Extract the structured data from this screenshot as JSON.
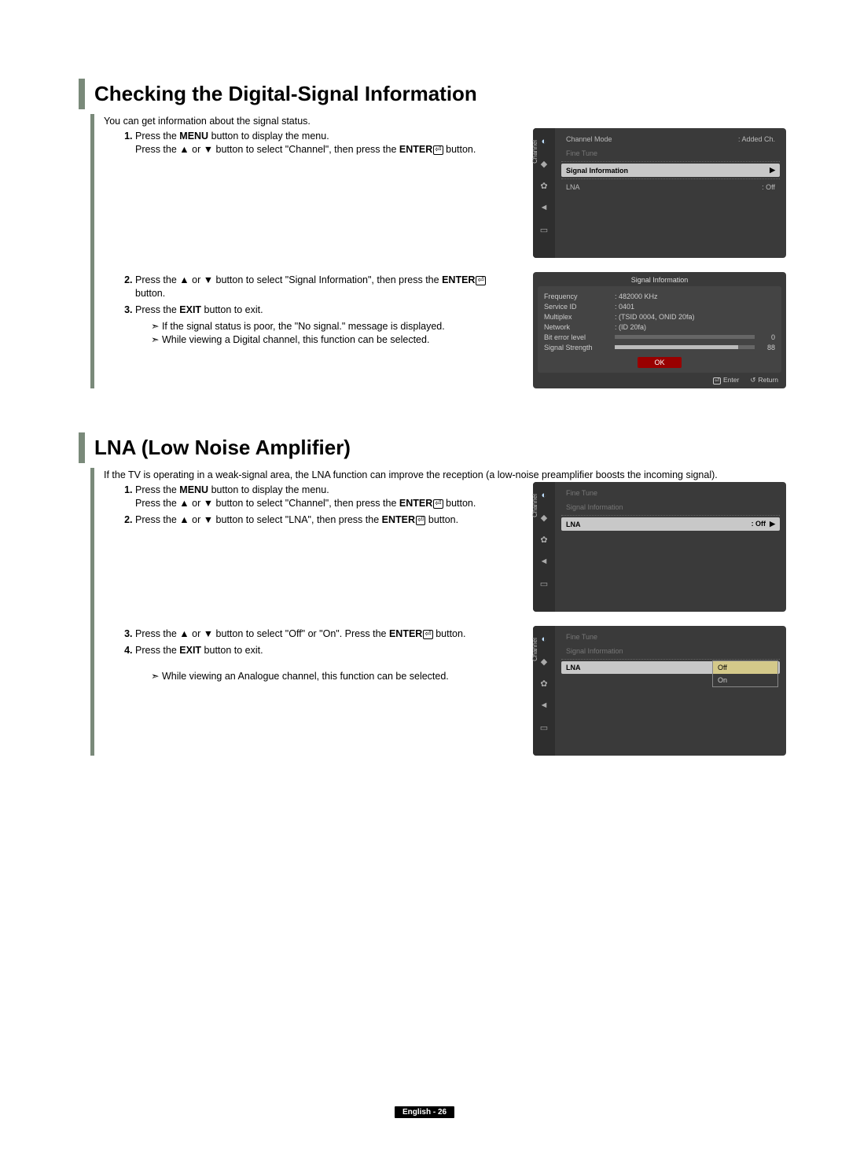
{
  "section1": {
    "title": "Checking the Digital-Signal Information",
    "intro": "You can get information about the signal status.",
    "steps": {
      "s1a": "Press the ",
      "s1_menu": "MENU",
      "s1b": " button to display the menu.",
      "s1c": "Press the ▲ or ▼ button to select \"Channel\", then press the ",
      "s1_enter": "ENTER",
      "s1d": " button.",
      "s2a": "Press the ▲ or ▼ button to select \"Signal Information\", then press the ",
      "s2_enter": "ENTER",
      "s2b": " button.",
      "s3a": "Press the ",
      "s3_exit": "EXIT",
      "s3b": " button to exit."
    },
    "notes": {
      "n1": "If the signal status is poor, the \"No signal.\" message is displayed.",
      "n2": "While viewing a Digital channel, this function can be selected."
    }
  },
  "section2": {
    "title": "LNA (Low Noise Amplifier)",
    "intro": "If the TV is operating in a weak-signal area, the LNA function can improve the reception (a low-noise preamplifier boosts the incoming signal).",
    "steps": {
      "s1a": "Press the ",
      "s1_menu": "MENU",
      "s1b": " button to display the menu.",
      "s1c": "Press the ▲ or ▼ button to select \"Channel\", then press the ",
      "s1_enter": "ENTER",
      "s1d": " button.",
      "s2a": "Press the ▲ or ▼ button to select \"LNA\", then press the ",
      "s2_enter": "ENTER",
      "s2b": " button.",
      "s3a": "Press the ▲ or ▼ button to select \"Off\" or \"On\". Press the ",
      "s3_enter": "ENTER",
      "s3b": " button.",
      "s4a": "Press the ",
      "s4_exit": "EXIT",
      "s4b": " button to exit."
    },
    "notes": {
      "n1": "While viewing an Analogue channel, this function can be selected."
    }
  },
  "osd_menu1": {
    "side_label": "Channel",
    "rows": {
      "r1_label": "Channel Mode",
      "r1_value": ": Added Ch.",
      "r2_label": "Fine Tune",
      "r3_label": "Signal Information",
      "r4_label": "LNA",
      "r4_value": ": Off"
    }
  },
  "osd_info": {
    "title": "Signal Information",
    "rows": {
      "freq_label": "Frequency",
      "freq_value": ": 482000 KHz",
      "svc_label": "Service ID",
      "svc_value": ": 0401",
      "mux_label": "Multiplex",
      "mux_value": ": (TSID 0004, ONID 20fa)",
      "net_label": "Network",
      "net_value": ": (ID 20fa)",
      "bit_label": "Bit error level",
      "bit_value": "0",
      "sig_label": "Signal Strength",
      "sig_value": "88"
    },
    "ok": "OK",
    "footer_enter": "Enter",
    "footer_return": "Return"
  },
  "osd_menu2": {
    "side_label": "Channel",
    "rows": {
      "r1_label": "Fine Tune",
      "r2_label": "Signal Information",
      "r3_label": "LNA",
      "r3_value": ": Off"
    }
  },
  "osd_menu3": {
    "side_label": "Channel",
    "rows": {
      "r1_label": "Fine Tune",
      "r2_label": "Signal Information",
      "r3_label": "LNA"
    },
    "options": {
      "off": "Off",
      "on": "On"
    }
  },
  "footer": {
    "text": "English - 26"
  },
  "chart_data": {
    "type": "bar",
    "title": "Signal Information meters",
    "series": [
      {
        "name": "Bit error level",
        "values": [
          0
        ],
        "range": [
          0,
          100
        ]
      },
      {
        "name": "Signal Strength",
        "values": [
          88
        ],
        "range": [
          0,
          100
        ]
      }
    ]
  }
}
